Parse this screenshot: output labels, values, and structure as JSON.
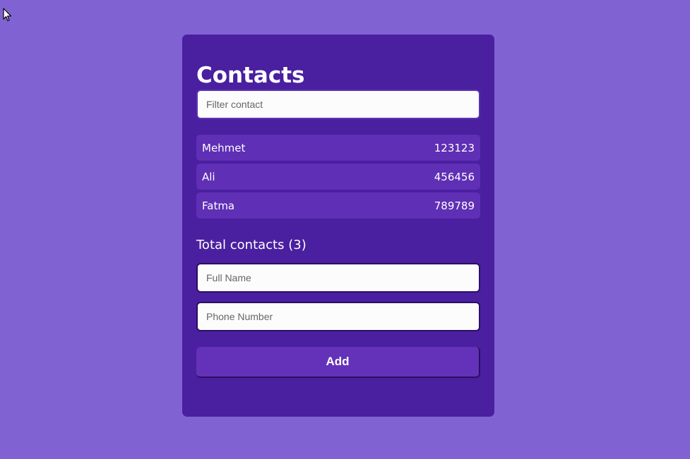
{
  "app": {
    "title": "Contacts"
  },
  "filter": {
    "placeholder": "Filter contact",
    "value": ""
  },
  "contacts": [
    {
      "name": "Mehmet",
      "phone": "123123"
    },
    {
      "name": "Ali",
      "phone": "456456"
    },
    {
      "name": "Fatma",
      "phone": "789789"
    }
  ],
  "summary": {
    "total_label": "Total contacts (3)"
  },
  "form": {
    "fullname_placeholder": "Full Name",
    "phone_placeholder": "Phone Number",
    "add_label": "Add"
  },
  "colors": {
    "page_background": "#8162d3",
    "card_background": "#4a1fa0",
    "item_background": "#5f2fb5",
    "button_background": "#6332b8",
    "text": "#ffffff"
  },
  "icons": {
    "cursor": "mouse-pointer-icon"
  }
}
